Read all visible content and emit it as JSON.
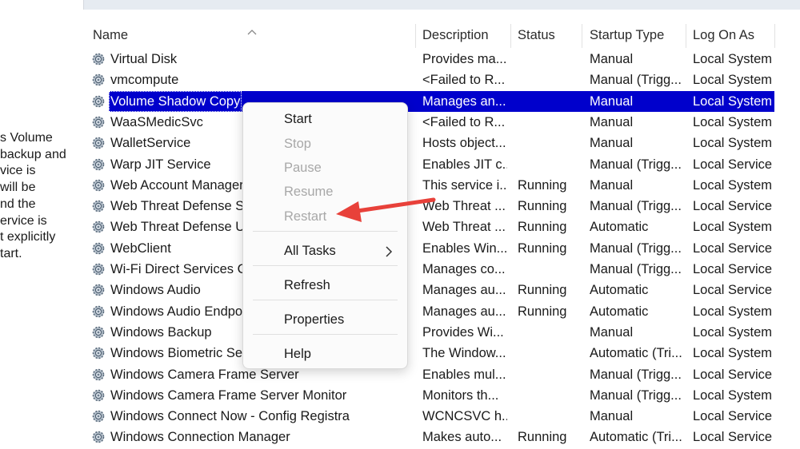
{
  "left_pane": {
    "description_lines": [
      "s Volume",
      "backup and",
      "vice is",
      "will be",
      "nd the",
      "ervice is",
      "t explicitly",
      "tart."
    ]
  },
  "header": {
    "name": "Name",
    "description": "Description",
    "status": "Status",
    "startup_type": "Startup Type",
    "log_on_as": "Log On As"
  },
  "services": [
    {
      "name": "Virtual Disk",
      "description": "Provides ma...",
      "status": "",
      "startup": "Manual",
      "logon": "Local System"
    },
    {
      "name": "vmcompute",
      "description": "<Failed to R...",
      "status": "",
      "startup": "Manual (Trigg...",
      "logon": "Local System"
    },
    {
      "name": "Volume Shadow Copy",
      "description": "Manages an...",
      "status": "",
      "startup": "Manual",
      "logon": "Local System"
    },
    {
      "name": "WaaSMedicSvc",
      "description": "<Failed to R...",
      "status": "",
      "startup": "Manual",
      "logon": "Local System"
    },
    {
      "name": "WalletService",
      "description": "Hosts object...",
      "status": "",
      "startup": "Manual",
      "logon": "Local System"
    },
    {
      "name": "Warp JIT Service",
      "description": "Enables JIT c...",
      "status": "",
      "startup": "Manual (Trigg...",
      "logon": "Local Service"
    },
    {
      "name": "Web Account Manager",
      "description": "This service i...",
      "status": "Running",
      "startup": "Manual",
      "logon": "Local System"
    },
    {
      "name": "Web Threat Defense Se",
      "description": "Web Threat ...",
      "status": "Running",
      "startup": "Manual (Trigg...",
      "logon": "Local Service"
    },
    {
      "name": "Web Threat Defense Us",
      "description": "Web Threat ...",
      "status": "Running",
      "startup": "Automatic",
      "logon": "Local System"
    },
    {
      "name": "WebClient",
      "description": "Enables Win...",
      "status": "Running",
      "startup": "Manual (Trigg...",
      "logon": "Local Service"
    },
    {
      "name": "Wi-Fi Direct Services Co",
      "description": "Manages co...",
      "status": "",
      "startup": "Manual (Trigg...",
      "logon": "Local Service"
    },
    {
      "name": "Windows Audio",
      "description": "Manages au...",
      "status": "Running",
      "startup": "Automatic",
      "logon": "Local Service"
    },
    {
      "name": "Windows Audio Endpo",
      "description": "Manages au...",
      "status": "Running",
      "startup": "Automatic",
      "logon": "Local System"
    },
    {
      "name": "Windows Backup",
      "description": "Provides Wi...",
      "status": "",
      "startup": "Manual",
      "logon": "Local System"
    },
    {
      "name": "Windows Biometric Ser",
      "description": "The Window...",
      "status": "",
      "startup": "Automatic (Tri...",
      "logon": "Local System"
    },
    {
      "name": "Windows Camera Frame Server",
      "description": "Enables mul...",
      "status": "",
      "startup": "Manual (Trigg...",
      "logon": "Local Service"
    },
    {
      "name": "Windows Camera Frame Server Monitor",
      "description": "Monitors th...",
      "status": "",
      "startup": "Manual (Trigg...",
      "logon": "Local System"
    },
    {
      "name": "Windows Connect Now - Config Registrar",
      "description": "WCNCSVC h...",
      "status": "",
      "startup": "Manual",
      "logon": "Local Service"
    },
    {
      "name": "Windows Connection Manager",
      "description": "Makes auto...",
      "status": "Running",
      "startup": "Automatic (Tri...",
      "logon": "Local Service"
    }
  ],
  "selected_index": 2,
  "context_menu": {
    "start": "Start",
    "stop": "Stop",
    "pause": "Pause",
    "resume": "Resume",
    "restart": "Restart",
    "all_tasks": "All Tasks",
    "refresh": "Refresh",
    "properties": "Properties",
    "help": "Help"
  },
  "colors": {
    "selection": "#0000cc",
    "annotation_arrow": "#e8413a",
    "disabled_text": "#a8a8a8"
  },
  "icons": {
    "service": "gear-icon",
    "submenu": "chevron-right-icon",
    "sort": "sort-ascending-icon"
  }
}
